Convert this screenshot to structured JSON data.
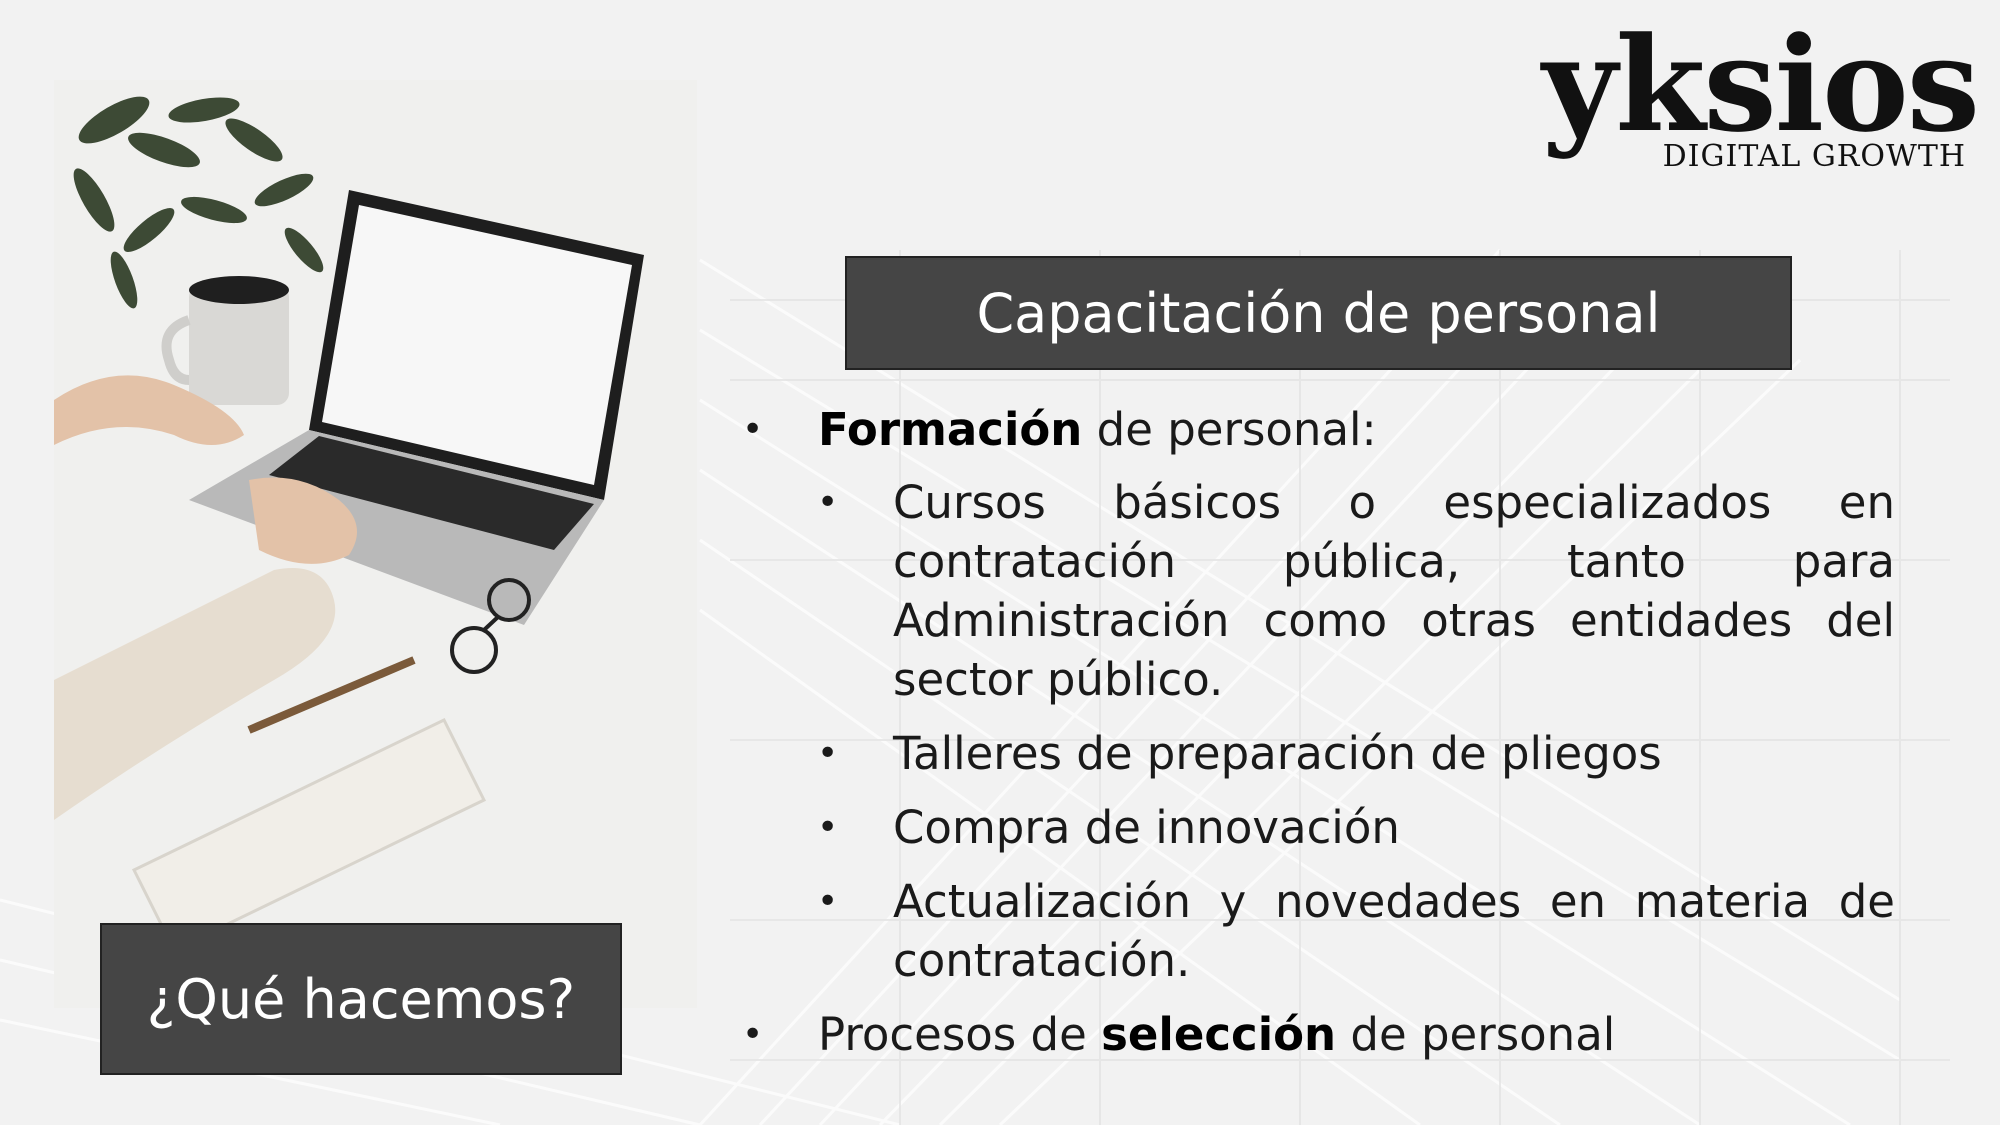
{
  "brand": {
    "wordmark": "yksios",
    "tagline": "DIGITAL GROWTH"
  },
  "photo": {
    "subject": "laptop-desk-photo"
  },
  "caption": "¿Qué hacemos?",
  "title": "Capacitación de personal",
  "content": {
    "item1": {
      "strong": "Formación",
      "rest": " de personal:",
      "subitems": [
        "Cursos básicos o especializados en contratación pública, tanto para Administración como otras entidades del sector público.",
        "Talleres de preparación de pliegos",
        "Compra de innovación",
        "Actualización y novedades en materia de contratación."
      ]
    },
    "item2": {
      "before": "Procesos de ",
      "strong": "selección",
      "after": " de personal"
    },
    "bullet": "•"
  },
  "colors": {
    "background": "#f2f2f2",
    "box": "#454545",
    "text": "#1a1a1a"
  }
}
